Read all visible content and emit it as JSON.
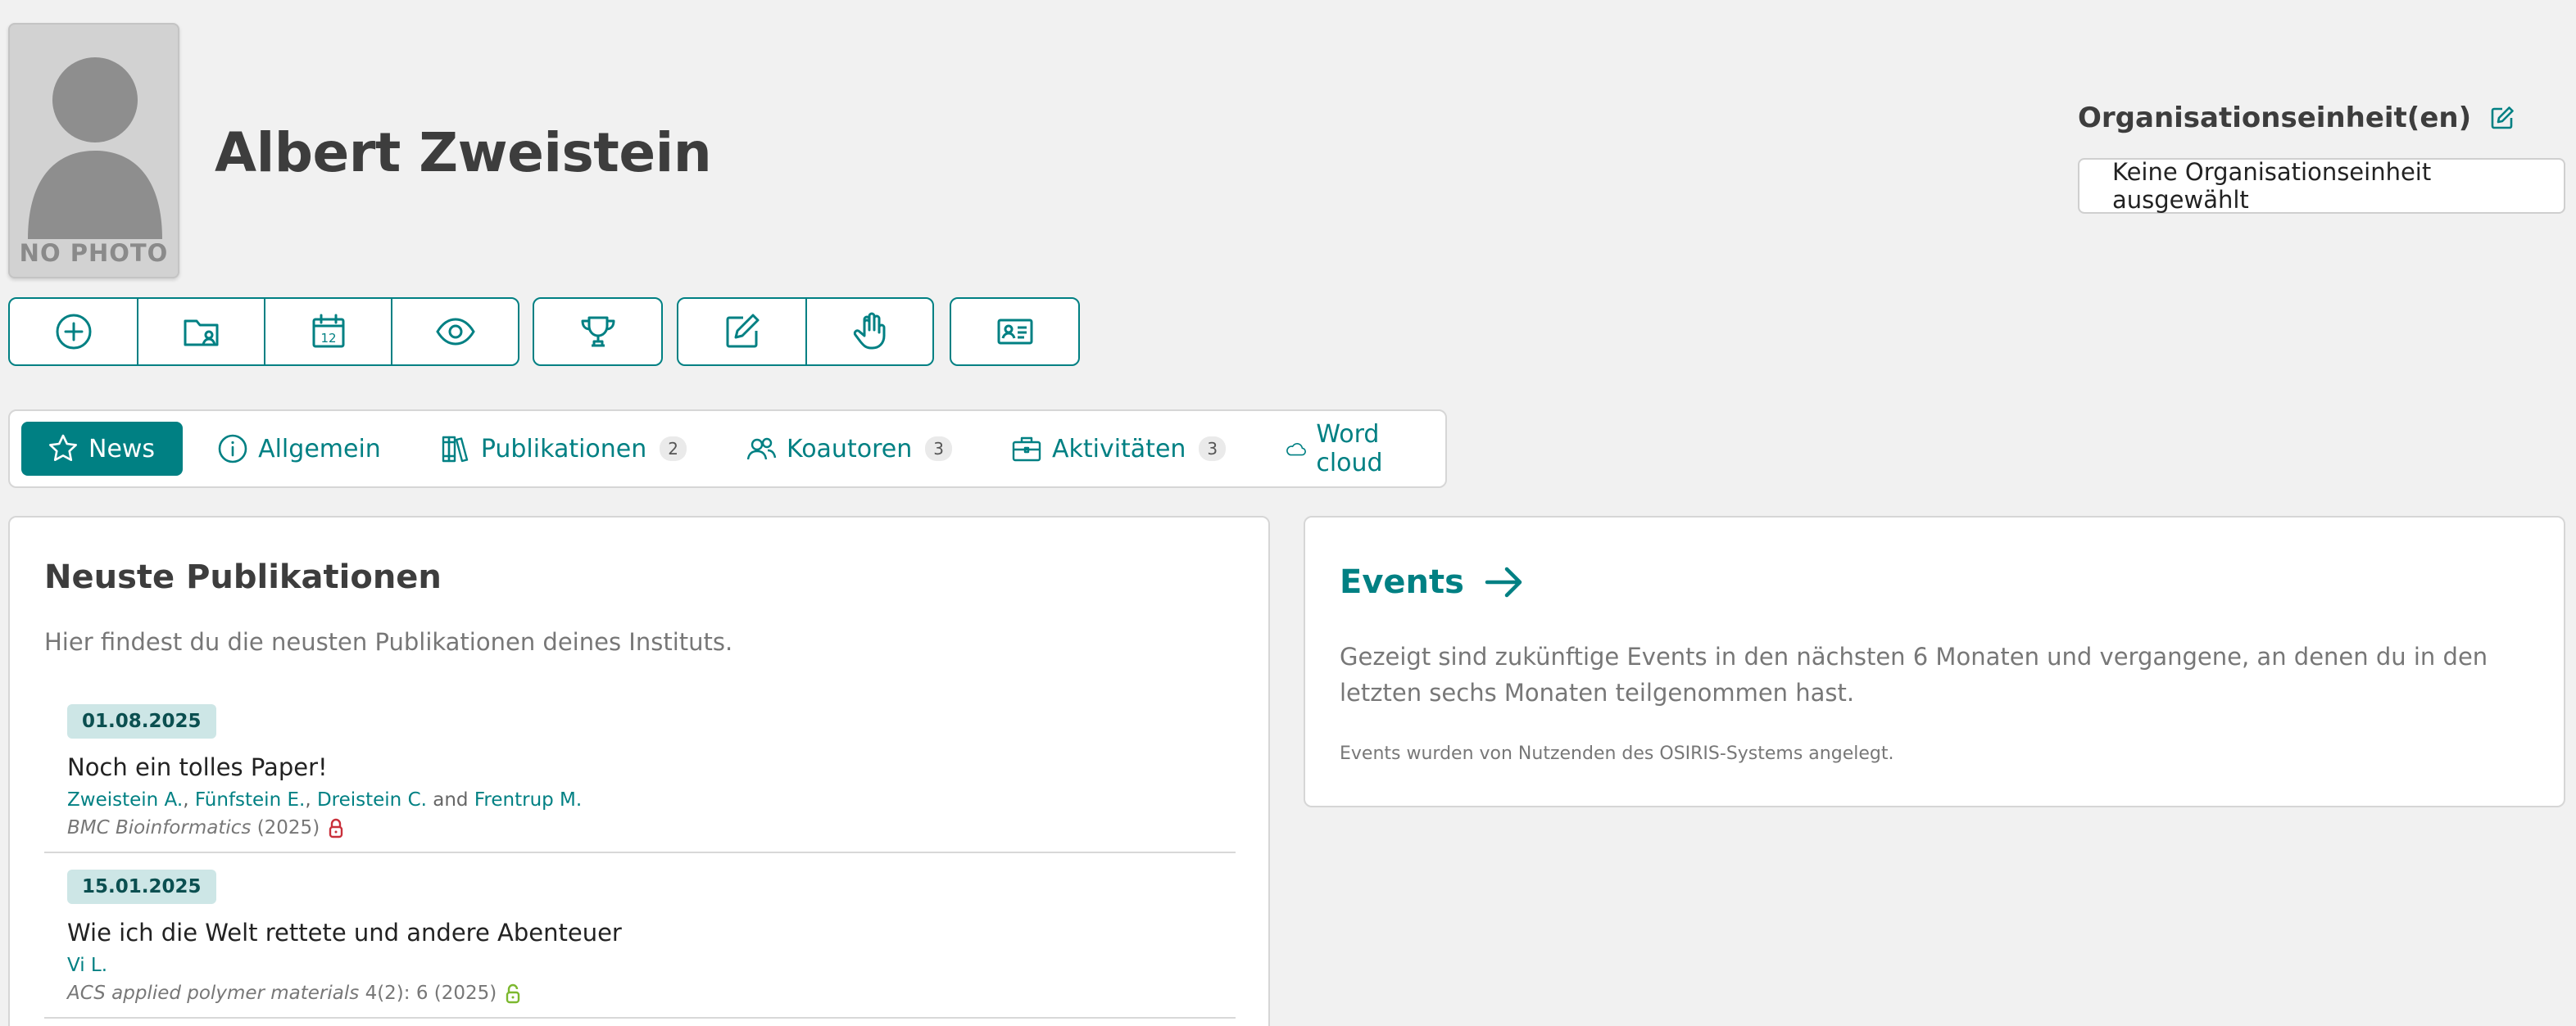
{
  "profile": {
    "name": "Albert Zweistein",
    "photo_placeholder": "NO PHOTO"
  },
  "org": {
    "title": "Organisationseinheit(en)",
    "value": "Keine Organisationseinheit ausgewählt"
  },
  "toolbar": {
    "groups": [
      [
        "add-circle-icon",
        "folder-user-icon",
        "calendar-12-icon",
        "eye-icon"
      ],
      [
        "trophy-icon"
      ],
      [
        "edit-icon",
        "hand-icon"
      ],
      [
        "id-card-icon"
      ]
    ]
  },
  "tabs": [
    {
      "label": "News",
      "icon": "star-icon",
      "active": true
    },
    {
      "label": "Allgemein",
      "icon": "info-icon"
    },
    {
      "label": "Publikationen",
      "icon": "books-icon",
      "count": "2"
    },
    {
      "label": "Koautoren",
      "icon": "users-icon",
      "count": "3"
    },
    {
      "label": "Aktivitäten",
      "icon": "briefcase-icon",
      "count": "3"
    },
    {
      "label": "Word cloud",
      "icon": "cloud-icon"
    }
  ],
  "publications_card": {
    "title": "Neuste Publikationen",
    "description": "Hier findest du die neusten Publikationen deines Instituts.",
    "items": [
      {
        "date": "01.08.2025",
        "title": "Noch ein tolles Paper!",
        "authors": [
          "Zweistein A.",
          "Fünfstein E.",
          "Dreistein C.",
          "Frentrup M."
        ],
        "sep": ", ",
        "and": " and ",
        "journal": "BMC Bioinformatics",
        "details": "(2025)",
        "access": "closed",
        "lock_color": "#c9303b"
      },
      {
        "date": "15.01.2025",
        "title": "Wie ich die Welt rettete und andere Abenteuer",
        "authors": [
          "Vi L."
        ],
        "sep": ", ",
        "and": " and ",
        "journal": "ACS applied polymer materials",
        "details": "4(2): 6 (2025)",
        "access": "open",
        "lock_color": "#7cb82f"
      }
    ]
  },
  "events_card": {
    "title": "Events",
    "description": "Gezeigt sind zukünftige Events in den nächsten 6 Monaten und vergangene, an denen du in den letzten sechs Monaten teilgenommen hast.",
    "note": "Events wurden von Nutzenden des OSIRIS-Systems angelegt."
  },
  "colors": {
    "accent": "#008083",
    "date_badge": "#cde6e6"
  }
}
